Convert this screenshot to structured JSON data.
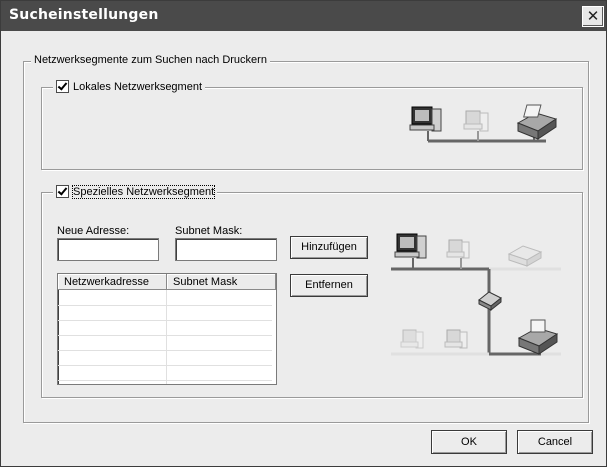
{
  "window": {
    "title": "Sucheinstellungen",
    "close_icon": "close-icon"
  },
  "segments_group": {
    "label": "Netzwerksegmente zum Suchen nach Druckern"
  },
  "local_segment": {
    "label": "Lokales Netzwerksegment",
    "checked": true
  },
  "special_segment": {
    "label": "Spezielles Netzwerksegment",
    "checked": true,
    "new_address_label": "Neue Adresse:",
    "new_address_value": "",
    "subnet_label": "Subnet Mask:",
    "subnet_value": "",
    "add_button": "Hinzufügen",
    "remove_button": "Entfernen",
    "table": {
      "columns": [
        "Netzwerkadresse",
        "Subnet Mask"
      ],
      "rows": []
    }
  },
  "footer": {
    "ok_button": "OK",
    "cancel_button": "Cancel"
  }
}
